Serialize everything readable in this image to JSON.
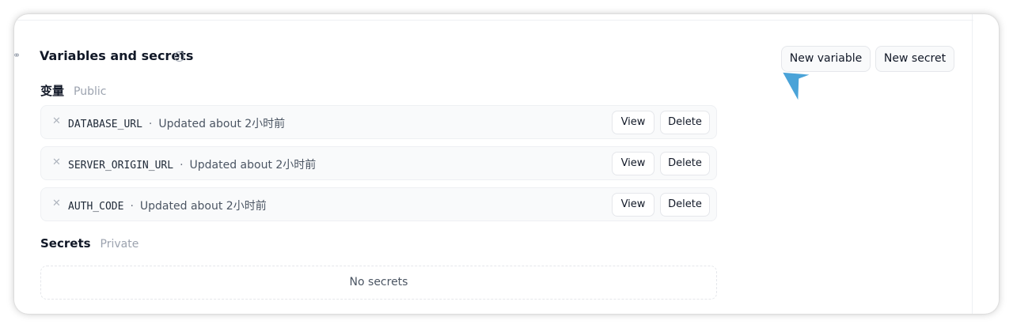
{
  "section": {
    "title": "Variables and secrets"
  },
  "actions": {
    "new_variable": "New variable",
    "new_secret": "New secret"
  },
  "variables": {
    "heading": "变量",
    "visibility": "Public",
    "items": [
      {
        "name": "DATABASE_URL",
        "separator": "·",
        "updated": "Updated about 2小时前",
        "view": "View",
        "delete": "Delete"
      },
      {
        "name": "SERVER_ORIGIN_URL",
        "separator": "·",
        "updated": "Updated about 2小时前",
        "view": "View",
        "delete": "Delete"
      },
      {
        "name": "AUTH_CODE",
        "separator": "·",
        "updated": "Updated about 2小时前",
        "view": "View",
        "delete": "Delete"
      }
    ]
  },
  "secrets": {
    "heading": "Secrets",
    "visibility": "Private",
    "empty_text": "No secrets"
  },
  "icons": {
    "link": "link-icon",
    "info": "info-icon",
    "variable": "x-variable-icon",
    "cursor": "mouse-pointer-icon"
  },
  "colors": {
    "cursor": "#4aa3d8",
    "muted_text": "#9ca3af"
  }
}
